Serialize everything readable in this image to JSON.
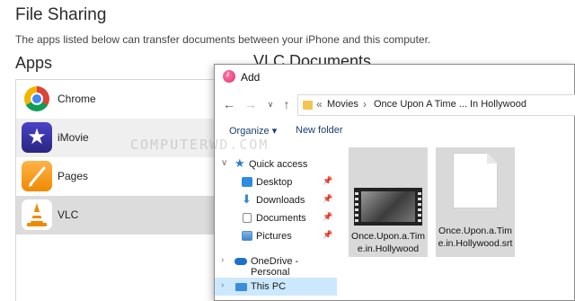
{
  "file_sharing": {
    "title": "File Sharing",
    "description": "The apps listed below can transfer documents between your iPhone and this computer.",
    "apps_heading": "Apps",
    "docs_heading": "VLC Documents",
    "apps": [
      {
        "label": "Chrome",
        "icon": "chrome-icon"
      },
      {
        "label": "iMovie",
        "icon": "imovie-icon"
      },
      {
        "label": "Pages",
        "icon": "pages-icon"
      },
      {
        "label": "VLC",
        "icon": "vlc-icon",
        "selected": true
      }
    ]
  },
  "watermark": "COMPUTERWD.COM",
  "dialog": {
    "title": "Add",
    "breadcrumb": [
      "Movies",
      "Once Upon A Time ... In Hollywood"
    ],
    "toolbar": {
      "organize": "Organize ▾",
      "new_folder": "New folder"
    },
    "nav": {
      "quick_access": "Quick access",
      "items": [
        "Desktop",
        "Downloads",
        "Documents",
        "Pictures"
      ],
      "onedrive": "OneDrive - Personal",
      "this_pc": "This PC"
    },
    "files": [
      {
        "name": "Once.Upon.a.Time.in.Hollywood",
        "type": "video"
      },
      {
        "name": "Once.Upon.a.Time.in.Hollywood.srt",
        "type": "document"
      }
    ]
  },
  "colors": {
    "selection_blue": "#cce8ff",
    "selected_row_gray": "#dcdcdc"
  }
}
